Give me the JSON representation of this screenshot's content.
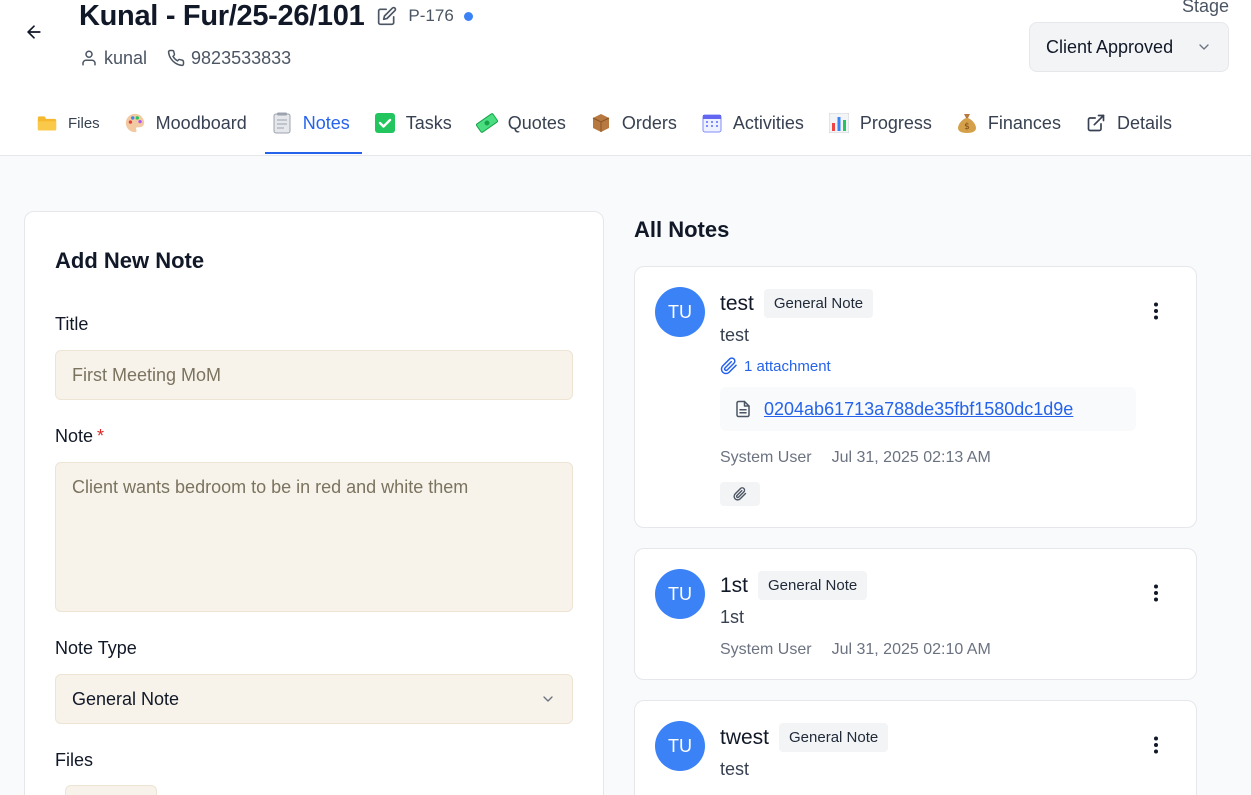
{
  "header": {
    "title": "Kunal - Fur/25-26/101",
    "project_id": "P-176",
    "client_name": "kunal",
    "phone": "9823533833",
    "stage_label": "Stage",
    "stage_value": "Client Approved"
  },
  "tabs": [
    {
      "label": "Files",
      "icon": "folder-icon"
    },
    {
      "label": "Moodboard",
      "icon": "palette-icon"
    },
    {
      "label": "Notes",
      "icon": "notepad-icon",
      "active": true
    },
    {
      "label": "Tasks",
      "icon": "checkbox-icon"
    },
    {
      "label": "Quotes",
      "icon": "money-icon"
    },
    {
      "label": "Orders",
      "icon": "package-icon"
    },
    {
      "label": "Activities",
      "icon": "calendar-icon"
    },
    {
      "label": "Progress",
      "icon": "bar-chart-icon"
    },
    {
      "label": "Finances",
      "icon": "money-bag-icon"
    },
    {
      "label": "Details",
      "icon": "external-link-icon"
    }
  ],
  "form": {
    "heading": "Add New Note",
    "title_label": "Title",
    "title_value": "First Meeting MoM",
    "note_label": "Note",
    "required_mark": "*",
    "note_value": "Client wants bedroom to be in red and white them",
    "type_label": "Note Type",
    "type_value": "General Note",
    "files_label": "Files"
  },
  "notes": {
    "heading": "All Notes",
    "items": [
      {
        "avatar": "TU",
        "title": "test",
        "badge": "General Note",
        "body": "test",
        "attachment_count": "1 attachment",
        "attachment_name": "0204ab61713a788de35fbf1580dc1d9e",
        "author": "System User",
        "date": "Jul 31, 2025 02:13 AM"
      },
      {
        "avatar": "TU",
        "title": "1st",
        "badge": "General Note",
        "body": "1st",
        "author": "System User",
        "date": "Jul 31, 2025 02:10 AM"
      },
      {
        "avatar": "TU",
        "title": "twest",
        "badge": "General Note",
        "body": "test"
      }
    ]
  },
  "colors": {
    "accent": "#2563eb",
    "avatar": "#3b82f6",
    "input_bg": "#f8f3ea"
  }
}
